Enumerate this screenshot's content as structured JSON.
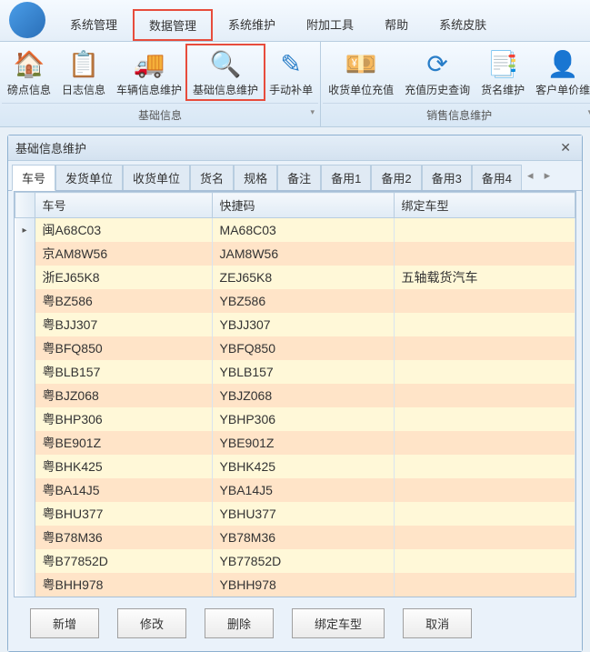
{
  "menu": {
    "items": [
      {
        "label": "系统管理"
      },
      {
        "label": "数据管理",
        "highlighted": true
      },
      {
        "label": "系统维护"
      },
      {
        "label": "附加工具"
      },
      {
        "label": "帮助"
      },
      {
        "label": "系统皮肤"
      }
    ]
  },
  "ribbon": {
    "groups": [
      {
        "label": "基础信息",
        "buttons": [
          {
            "label": "磅点信息",
            "icon": "🏠"
          },
          {
            "label": "日志信息",
            "icon": "📋"
          },
          {
            "label": "车辆信息维护",
            "icon": "🚚"
          },
          {
            "label": "基础信息维护",
            "icon": "🔍",
            "highlighted": true
          },
          {
            "label": "手动补单",
            "icon": "✎"
          }
        ]
      },
      {
        "label": "销售信息维护",
        "buttons": [
          {
            "label": "收货单位充值",
            "icon": "💴"
          },
          {
            "label": "充值历史查询",
            "icon": "⟳"
          },
          {
            "label": "货名维护",
            "icon": "📑"
          },
          {
            "label": "客户单价维",
            "icon": "👤"
          }
        ]
      }
    ]
  },
  "dialog": {
    "title": "基础信息维护"
  },
  "tabs": {
    "items": [
      {
        "label": "车号",
        "active": true
      },
      {
        "label": "发货单位"
      },
      {
        "label": "收货单位"
      },
      {
        "label": "货名"
      },
      {
        "label": "规格"
      },
      {
        "label": "备注"
      },
      {
        "label": "备用1"
      },
      {
        "label": "备用2"
      },
      {
        "label": "备用3"
      },
      {
        "label": "备用4"
      }
    ]
  },
  "grid": {
    "columns": [
      "车号",
      "快捷码",
      "绑定车型"
    ],
    "rows": [
      {
        "c0": "闽A68C03",
        "c1": "MA68C03",
        "c2": "",
        "current": true
      },
      {
        "c0": "京AM8W56",
        "c1": "JAM8W56",
        "c2": ""
      },
      {
        "c0": "浙EJ65K8",
        "c1": "ZEJ65K8",
        "c2": "五轴载货汽车"
      },
      {
        "c0": "粤BZ586",
        "c1": "YBZ586",
        "c2": ""
      },
      {
        "c0": "粤BJJ307",
        "c1": "YBJJ307",
        "c2": ""
      },
      {
        "c0": "粤BFQ850",
        "c1": "YBFQ850",
        "c2": ""
      },
      {
        "c0": "粤BLB157",
        "c1": "YBLB157",
        "c2": ""
      },
      {
        "c0": "粤BJZ068",
        "c1": "YBJZ068",
        "c2": ""
      },
      {
        "c0": "粤BHP306",
        "c1": "YBHP306",
        "c2": ""
      },
      {
        "c0": "粤BE901Z",
        "c1": "YBE901Z",
        "c2": ""
      },
      {
        "c0": "粤BHK425",
        "c1": "YBHK425",
        "c2": ""
      },
      {
        "c0": "粤BA14J5",
        "c1": "YBA14J5",
        "c2": ""
      },
      {
        "c0": "粤BHU377",
        "c1": "YBHU377",
        "c2": ""
      },
      {
        "c0": "粤B78M36",
        "c1": "YB78M36",
        "c2": ""
      },
      {
        "c0": "粤B77852D",
        "c1": "YB77852D",
        "c2": ""
      },
      {
        "c0": "粤BHH978",
        "c1": "YBHH978",
        "c2": ""
      }
    ]
  },
  "buttons": {
    "add": "新增",
    "edit": "修改",
    "delete": "删除",
    "bind": "绑定车型",
    "cancel": "取消"
  }
}
